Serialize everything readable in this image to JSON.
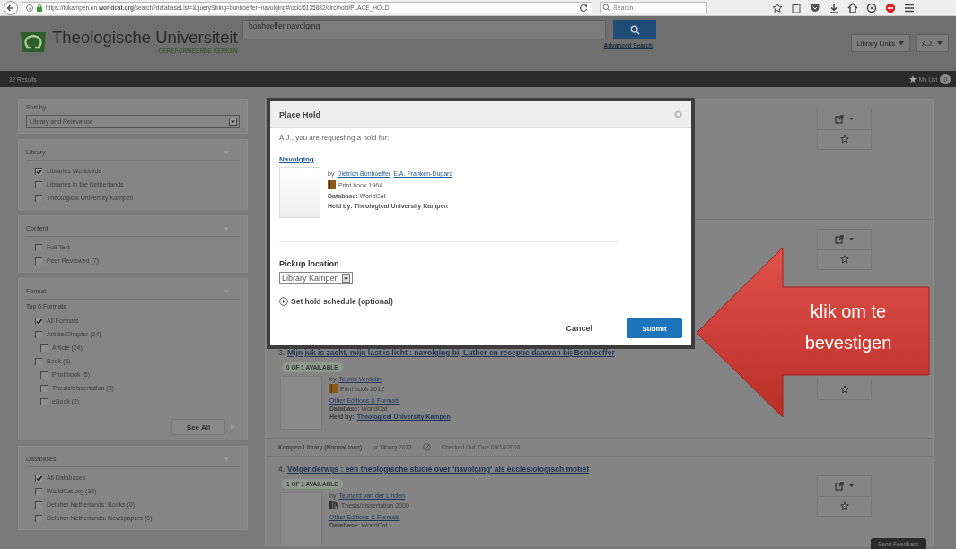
{
  "browser": {
    "url": "https://tukampen.on.**worldcat.org**/search?databaseList=&queryString=bonhoeffer+navolging#/oclc/6135882/circ/hold/PLACE_HOLD",
    "search_placeholder": "Search"
  },
  "header": {
    "logo_title": "Theologische Universiteit",
    "logo_subtitle": "GEREFORMEERDE KERKEN",
    "query": "bonhoeffer navolging",
    "advanced_search": "Advanced Search",
    "menus": [
      "Library Links",
      "A.J."
    ]
  },
  "results_bar": {
    "count": "32 Results",
    "my_list": "My List",
    "my_list_count": "0"
  },
  "sidebar": {
    "sort": {
      "label": "Sort by",
      "value": "Library and Relevance"
    },
    "facets": [
      {
        "title": "Library",
        "options": [
          {
            "label": "Libraries Worldwide",
            "checked": true
          },
          {
            "label": "Libraries in the Netherlands",
            "checked": false
          },
          {
            "label": "Theological University Kampen",
            "checked": false
          }
        ]
      },
      {
        "title": "Content",
        "options": [
          {
            "label": "Full Text",
            "checked": false
          },
          {
            "label": "Peer Reviewed (7)",
            "checked": false
          }
        ]
      },
      {
        "title": "Format",
        "subheading": "Top 6 Formats",
        "options": [
          {
            "label": "All Formats",
            "checked": true
          },
          {
            "label": "Article/Chapter (24)",
            "checked": false,
            "children": [
              {
                "label": "Article (24)",
                "checked": false
              }
            ]
          },
          {
            "label": "Book (8)",
            "checked": false,
            "children": [
              {
                "label": "Print book (5)",
                "checked": false
              },
              {
                "label": "Thesis/dissertation (3)",
                "checked": false
              },
              {
                "label": "eBook (2)",
                "checked": false
              }
            ]
          }
        ],
        "see_all": "See All"
      },
      {
        "title": "Databases",
        "options": [
          {
            "label": "All Databases",
            "checked": true
          },
          {
            "label": "WorldCat.org (32)",
            "checked": false
          },
          {
            "label": "Delpher Netherlands: Books (0)",
            "checked": false
          },
          {
            "label": "Delpher Netherlands: Newspapers (0)",
            "checked": false
          }
        ]
      }
    ]
  },
  "results": [
    {
      "number": "3.",
      "title": "Mijn juk is zacht, mijn last is licht : navolging bij Luther en receptie daarvan bij Bonhoeffer",
      "availability": "0 OF 1 AVAILABLE",
      "by": "by",
      "authors": [
        "Teunis Verduijn"
      ],
      "format": {
        "kind": "book",
        "text": "Print book 2012"
      },
      "other_editions": "Other Editions & Formats",
      "database": "**Database:** WorldCat",
      "held_by_label": "Held by:",
      "held_by": "Theological University Kampen",
      "holding": {
        "location": "Kampen Library (Normal loan)",
        "call_number": "pr Tilburg 2012",
        "status": "Checked Out, Due 09/14/2016"
      }
    },
    {
      "number": "4.",
      "title": "Volgenderwijs : een theologische studie over 'navolging' als ecclesiologisch motief",
      "availability": "1 OF 1 AVAILABLE",
      "by": "by",
      "authors": [
        "Teunard van der Linden"
      ],
      "format": {
        "kind": "thesis",
        "text": "Thesis/dissertation 2000"
      },
      "other_editions": "Other Editions & Formats",
      "database": "**Database:** WorldCat"
    }
  ],
  "modal": {
    "title": "Place Hold",
    "intro": "A.J., you are requesting a hold for:",
    "item_title": "Navolging",
    "by": "by",
    "authors": [
      "Dietrich Bonhoeffer",
      "E.A. Franken-Duparc"
    ],
    "format": {
      "kind": "book",
      "text": "Print book 1964."
    },
    "database": "**Database:** WorldCat",
    "held_by": "Held by: Theological University Kampen",
    "pickup_label": "Pickup location",
    "pickup_value": "Library Kampen",
    "schedule": "Set hold schedule (optional)",
    "cancel": "Cancel",
    "submit": "Submit"
  },
  "annotation": {
    "text": "klik om te bevestigen"
  },
  "feedback": "Send Feedback"
}
